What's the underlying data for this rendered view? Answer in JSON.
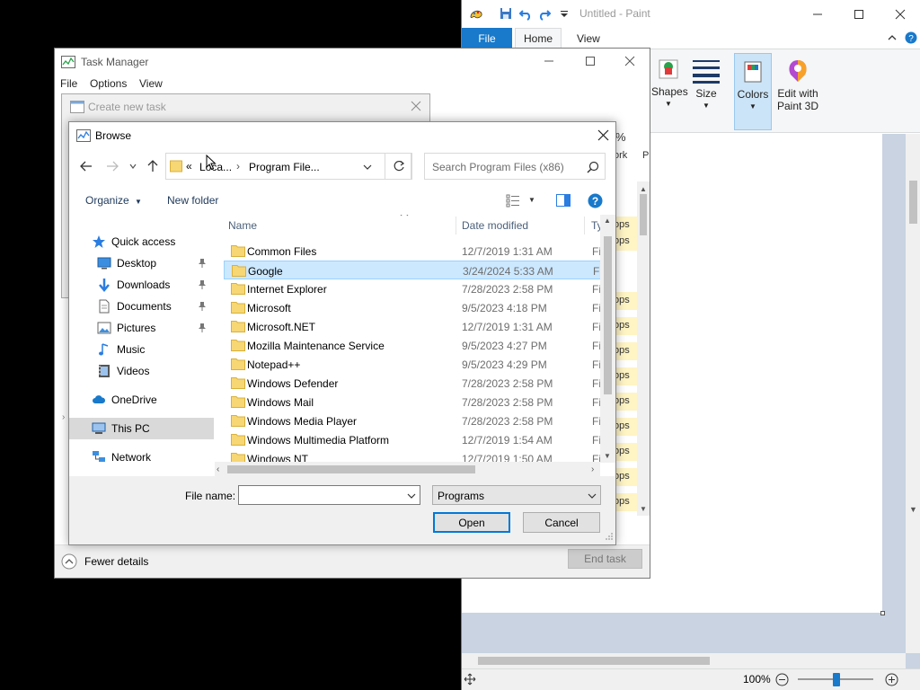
{
  "paint": {
    "title": "Untitled - Paint",
    "tabs": {
      "file": "File",
      "home": "Home",
      "view": "View"
    },
    "ribbon": {
      "shapes": "Shapes",
      "size": "Size",
      "colors": "Colors",
      "edit_line1": "Edit with",
      "edit_line2": "Paint 3D"
    },
    "zoom": "100%",
    "accent": "#1979ca"
  },
  "task_manager": {
    "title": "Task Manager",
    "menu": {
      "file": "File",
      "options": "Options",
      "view": "View"
    },
    "fewer_details": "Fewer details",
    "end_task": "End task",
    "partial_percent": "%",
    "partial_work": "ork",
    "partial_p": "P",
    "partial_app_rows": [
      "ops",
      "ops",
      "ops",
      "ops",
      "ops",
      "ops",
      "ops",
      "ops",
      "ops",
      "ops",
      "ops"
    ]
  },
  "create_task": {
    "title": "Create new task"
  },
  "browse": {
    "title": "Browse",
    "address": {
      "chevron": "«",
      "crumb1": "Loca...",
      "crumb2": "Program File..."
    },
    "search_placeholder": "Search Program Files (x86)",
    "toolbar": {
      "organize": "Organize",
      "new_folder": "New folder"
    },
    "nav": [
      {
        "label": "Quick access",
        "icon": "star-icon"
      },
      {
        "label": "Desktop",
        "icon": "desktop-icon"
      },
      {
        "label": "Downloads",
        "icon": "download-icon"
      },
      {
        "label": "Documents",
        "icon": "documents-icon"
      },
      {
        "label": "Pictures",
        "icon": "pictures-icon"
      },
      {
        "label": "Music",
        "icon": "music-icon"
      },
      {
        "label": "Videos",
        "icon": "videos-icon"
      },
      {
        "label": "OneDrive",
        "icon": "cloud-icon"
      },
      {
        "label": "This PC",
        "icon": "computer-icon"
      },
      {
        "label": "Network",
        "icon": "network-icon"
      }
    ],
    "columns": {
      "name": "Name",
      "date": "Date modified",
      "type": "Ty"
    },
    "files": [
      {
        "name": "Common Files",
        "date": "12/7/2019 1:31 AM",
        "type": "Fi"
      },
      {
        "name": "Google",
        "date": "3/24/2024 5:33 AM",
        "type": "Fi"
      },
      {
        "name": "Internet Explorer",
        "date": "7/28/2023 2:58 PM",
        "type": "Fi"
      },
      {
        "name": "Microsoft",
        "date": "9/5/2023 4:18 PM",
        "type": "Fi"
      },
      {
        "name": "Microsoft.NET",
        "date": "12/7/2019 1:31 AM",
        "type": "Fi"
      },
      {
        "name": "Mozilla Maintenance Service",
        "date": "9/5/2023 4:27 PM",
        "type": "Fi"
      },
      {
        "name": "Notepad++",
        "date": "9/5/2023 4:29 PM",
        "type": "Fi"
      },
      {
        "name": "Windows Defender",
        "date": "7/28/2023 2:58 PM",
        "type": "Fi"
      },
      {
        "name": "Windows Mail",
        "date": "7/28/2023 2:58 PM",
        "type": "Fi"
      },
      {
        "name": "Windows Media Player",
        "date": "7/28/2023 2:58 PM",
        "type": "Fi"
      },
      {
        "name": "Windows Multimedia Platform",
        "date": "12/7/2019 1:54 AM",
        "type": "Fi"
      },
      {
        "name": "Windows NT",
        "date": "12/7/2019 1:50 AM",
        "type": "Fi"
      }
    ],
    "file_name_label": "File name:",
    "file_name_value": "",
    "file_type": "Programs",
    "open": "Open",
    "cancel": "Cancel",
    "selection_color": "#cce8ff"
  }
}
